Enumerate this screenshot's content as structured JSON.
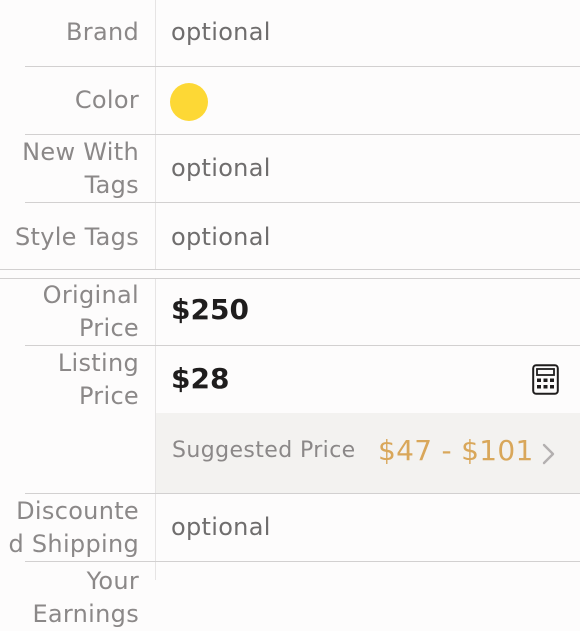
{
  "form": {
    "brand": {
      "label": "Brand",
      "placeholder": "optional"
    },
    "color": {
      "label": "Color",
      "swatch_color": "#FDD835"
    },
    "new_with_tags": {
      "label_line1": "New With",
      "label_line2": "Tags",
      "placeholder": "optional"
    },
    "style_tags": {
      "label": "Style Tags",
      "placeholder": "optional"
    },
    "original_price": {
      "label_line1": "Original",
      "label_line2": "Price",
      "value": "$250"
    },
    "listing_price": {
      "label_line1": "Listing",
      "label_line2": "Price",
      "value": "$28",
      "calculator_icon": "calculator-icon",
      "suggested": {
        "label": "Suggested Price",
        "range": "$47 - $101",
        "chevron_icon": "chevron-right-icon"
      }
    },
    "discounted_shipping": {
      "label_line1": "Discounte",
      "label_line2": "d Shipping",
      "placeholder": "optional"
    },
    "partial_next": {
      "label": "Your Earnings"
    }
  },
  "colors": {
    "suggested_price_accent": "#D9A75A",
    "suggested_bg": "#F3F2F0"
  }
}
